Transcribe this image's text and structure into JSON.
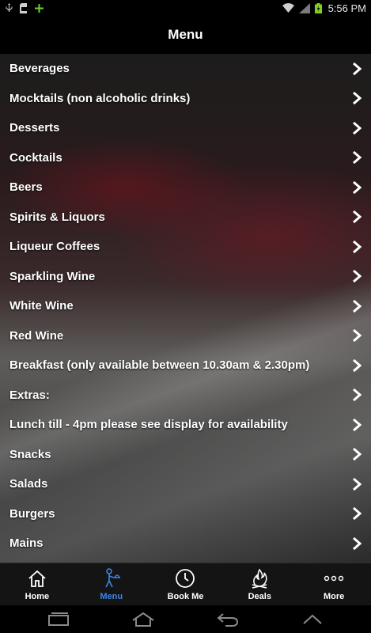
{
  "status_bar": {
    "time": "5:56 PM"
  },
  "title": "Menu",
  "menu_items": [
    "Beverages",
    "Mocktails (non alcoholic drinks)",
    "Desserts",
    "Cocktails",
    "Beers",
    "Spirits & Liquors",
    "Liqueur Coffees",
    "Sparkling Wine",
    "White Wine",
    "Red Wine",
    "Breakfast (only available between 10.30am & 2.30pm)",
    "Extras:",
    "Lunch till - 4pm please see display for availability",
    "Snacks",
    "Salads",
    "Burgers",
    "Mains"
  ],
  "tabs": [
    {
      "label": "Home",
      "icon": "home-icon"
    },
    {
      "label": "Menu",
      "icon": "menu-waiter-icon",
      "active": true
    },
    {
      "label": "Book Me",
      "icon": "clock-icon"
    },
    {
      "label": "Deals",
      "icon": "fire-icon"
    },
    {
      "label": "More",
      "icon": "more-dots-icon"
    }
  ],
  "colors": {
    "active_tab": "#3b86e6",
    "status_battery": "#7ed321"
  }
}
